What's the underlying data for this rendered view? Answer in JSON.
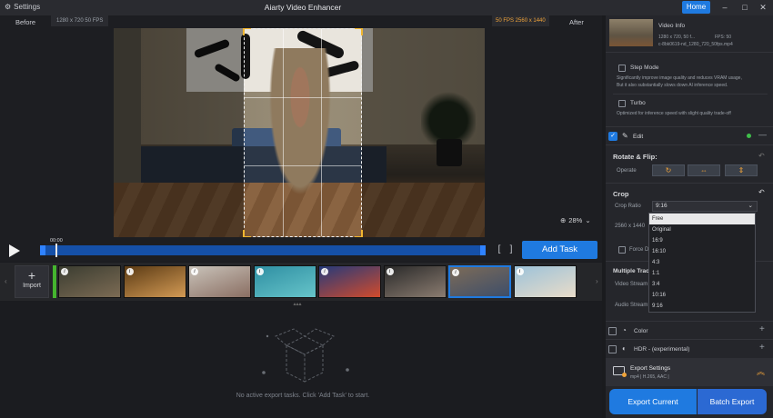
{
  "titlebar": {
    "settings_label": "Settings",
    "title": "Aiarty Video Enhancer",
    "home_label": "Home"
  },
  "preview": {
    "before_label": "Before",
    "after_label": "After",
    "source_info": "1280 x 720  50 FPS",
    "output_info": "50 FPS  2560 x 1440",
    "zoom_label": "28%"
  },
  "transport": {
    "timecode": "00:00",
    "add_task_label": "Add Task"
  },
  "strip": {
    "import_label": "Import",
    "thumbnails": [
      {
        "colors": [
          "#3b3d31",
          "#7c6b54"
        ]
      },
      {
        "colors": [
          "#5b3b15",
          "#d39a54"
        ]
      },
      {
        "colors": [
          "#c9c3ba",
          "#8a6e62"
        ]
      },
      {
        "colors": [
          "#2f8fa3",
          "#66c4c9"
        ]
      },
      {
        "colors": [
          "#253a7a",
          "#d24b2c"
        ]
      },
      {
        "colors": [
          "#2a2a2a",
          "#8b7c70"
        ]
      },
      {
        "colors": [
          "#7c6b58",
          "#3e4e69"
        ],
        "selected": true
      },
      {
        "colors": [
          "#9cc2d9",
          "#e9dcc9"
        ]
      }
    ]
  },
  "tasks": {
    "empty_message": "No active export tasks. Click 'Add Task' to start."
  },
  "panel": {
    "video_info_title": "Video Info",
    "video_info_line1": "1280 x 720, 50 f...",
    "video_info_line2": "FPS: 50",
    "video_info_line3": "c-8bk0619-nd_1280_720_50fps.mp4",
    "step_mode_label": "Step Mode",
    "step_mode_desc_1": "Significantly improve image quality and reduces VRAM usage,",
    "step_mode_desc_2": "But it also substantially slows down AI inference speed.",
    "turbo_label": "Turbo",
    "turbo_desc": "Optimized for inference speed with slight quality trade-off",
    "edit_label": "Edit",
    "rotate_title": "Rotate & Flip:",
    "operate_label": "Operate",
    "crop_title": "Crop",
    "crop_ratio_label": "Crop Ratio",
    "crop_ratio_value": "9:16",
    "resolution_label": "2560 x 1440",
    "force_label": "Force De",
    "multiple_tracks_label": "Multiple Trac",
    "video_stream_label": "Video Stream",
    "audio_stream_label": "Audio Stream",
    "crop_options": [
      "Free",
      "Original",
      "16:9",
      "16:10",
      "4:3",
      "1:1",
      "3:4",
      "10:16",
      "9:16"
    ],
    "color_label": "Color",
    "hdr_label": "HDR - (experimental)",
    "export_settings_title": "Export Settings",
    "export_settings_sub": "mp4 | H.265, AAC |",
    "export_current_label": "Export Current",
    "batch_export_label": "Batch Export"
  }
}
